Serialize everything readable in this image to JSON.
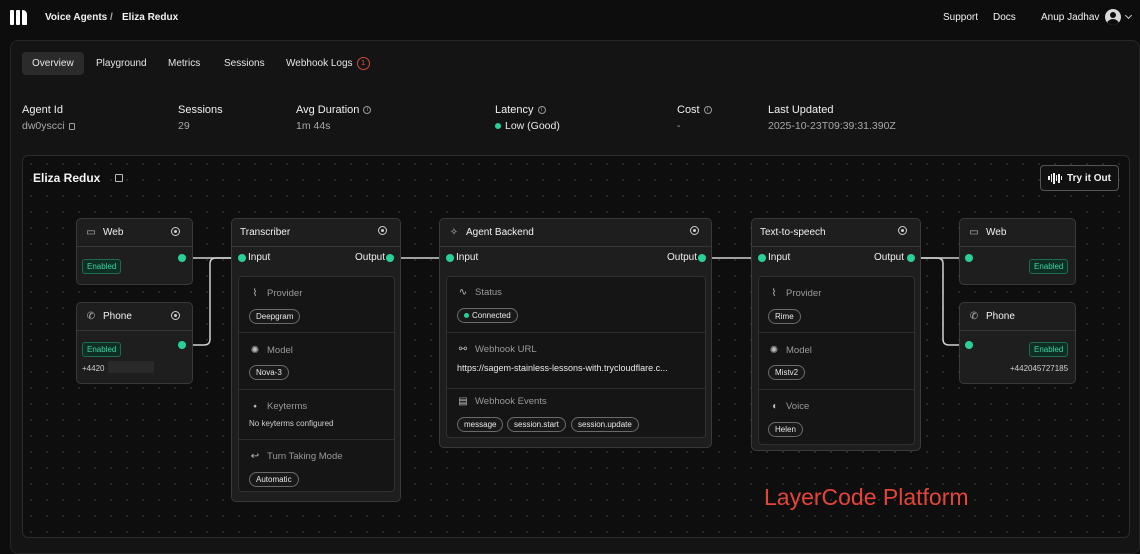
{
  "breadcrumb": {
    "root": "Voice Agents",
    "separator": "/",
    "current": "Eliza Redux"
  },
  "top_nav": {
    "support": "Support",
    "docs": "Docs",
    "user": "Anup Jadhav"
  },
  "tabs": [
    {
      "label": "Overview",
      "active": true
    },
    {
      "label": "Playground"
    },
    {
      "label": "Metrics"
    },
    {
      "label": "Sessions"
    },
    {
      "label": "Webhook Logs",
      "badge": "1"
    }
  ],
  "stats": {
    "agent_id": {
      "label": "Agent Id",
      "value": "dw0yscci"
    },
    "sessions": {
      "label": "Sessions",
      "value": "29"
    },
    "avg_duration": {
      "label": "Avg Duration",
      "value": "1m 44s"
    },
    "latency": {
      "label": "Latency",
      "value": "Low (Good)"
    },
    "cost": {
      "label": "Cost",
      "value": "-"
    },
    "last_updated": {
      "label": "Last Updated",
      "value": "2025-10-23T09:39:31.390Z"
    }
  },
  "canvas": {
    "title": "Eliza Redux",
    "try_button": "Try it Out",
    "web_in": {
      "title": "Web",
      "status": "Enabled"
    },
    "phone_in": {
      "title": "Phone",
      "status": "Enabled",
      "number": "+4420"
    },
    "transcriber": {
      "title": "Transcriber",
      "input": "Input",
      "output": "Output",
      "provider_label": "Provider",
      "provider": "Deepgram",
      "model_label": "Model",
      "model": "Nova-3",
      "keyterms_label": "Keyterms",
      "keyterms": "No keyterms configured",
      "turn_label": "Turn Taking Mode",
      "turn": "Automatic"
    },
    "agent_backend": {
      "title": "Agent Backend",
      "input": "Input",
      "output": "Output",
      "status_label": "Status",
      "status": "Connected",
      "webhook_url_label": "Webhook URL",
      "webhook_url": "https://sagem-stainless-lessons-with.trycloudflare.c...",
      "events_label": "Webhook Events",
      "events": [
        "message",
        "session.start",
        "session.update"
      ]
    },
    "tts": {
      "title": "Text-to-speech",
      "input": "Input",
      "output": "Output",
      "provider_label": "Provider",
      "provider": "Rime",
      "model_label": "Model",
      "model": "Mistv2",
      "voice_label": "Voice",
      "voice": "Helen"
    },
    "web_out": {
      "title": "Web",
      "status": "Enabled"
    },
    "phone_out": {
      "title": "Phone",
      "status": "Enabled",
      "number": "+442045727185"
    }
  },
  "brand_footer": "LayerCode Platform",
  "colors": {
    "accent_green": "#2ad09a",
    "badge_red": "#d04a3c",
    "brand_red": "#e5443a"
  }
}
